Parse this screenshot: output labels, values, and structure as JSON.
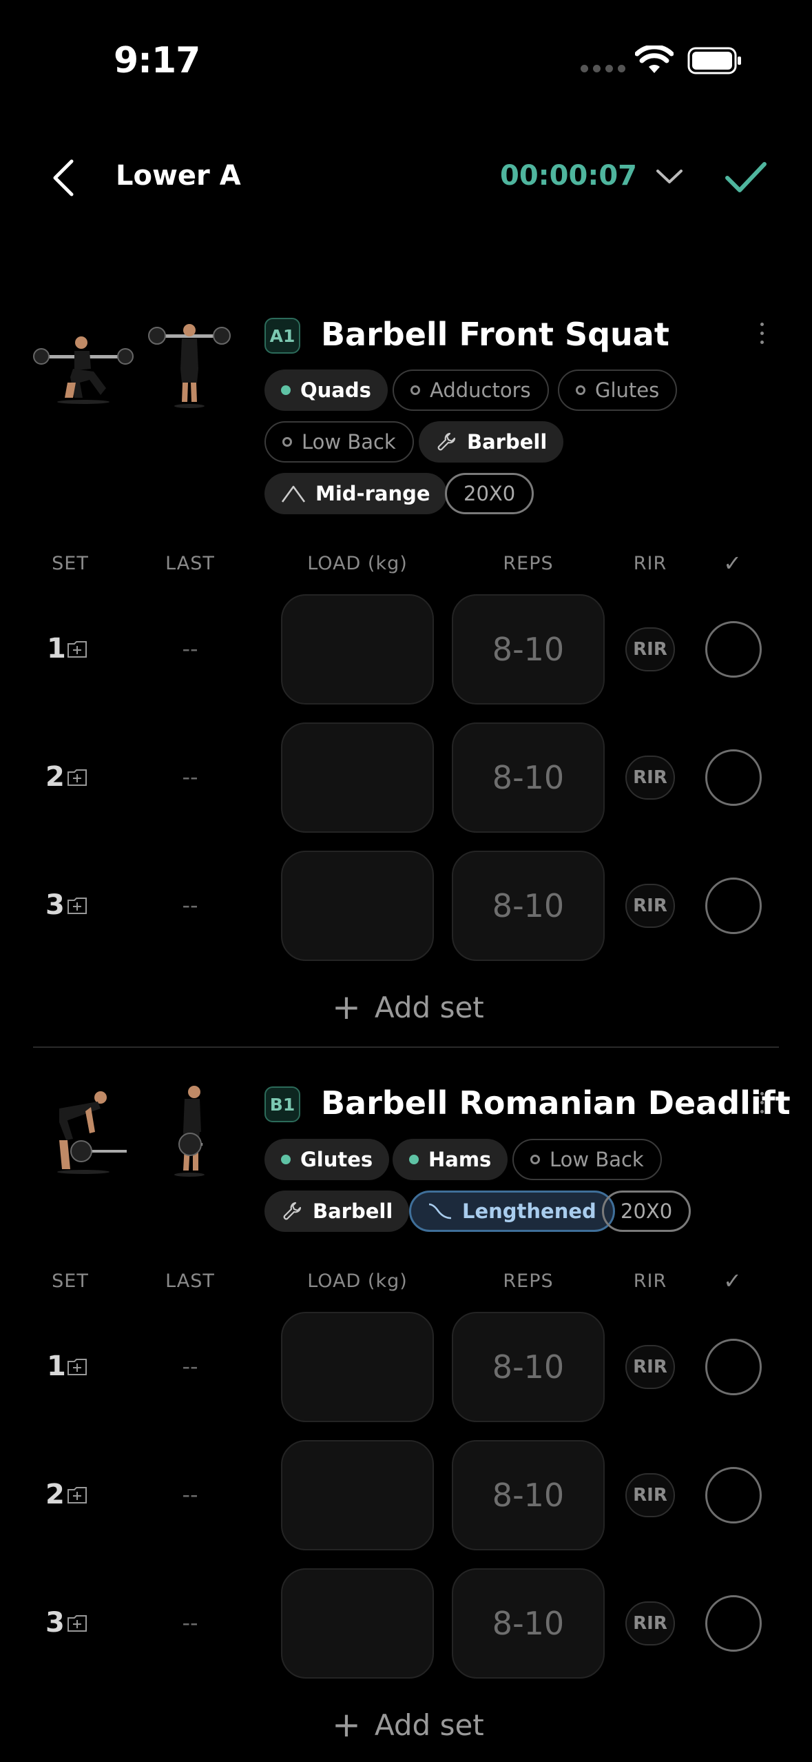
{
  "status_bar": {
    "time": "9:17"
  },
  "header": {
    "title": "Lower A",
    "timer": "00:00:07"
  },
  "exercises": [
    {
      "label": "A1",
      "name": "Barbell Front Squat",
      "chips": [
        "Quads",
        "Adductors",
        "Glutes",
        "Low Back",
        "Barbell",
        "Mid-range",
        "20X0"
      ],
      "columns": {
        "set": "SET",
        "last": "LAST",
        "load": "LOAD (kg)",
        "reps": "REPS",
        "rir": "RIR",
        "check": "✓"
      },
      "sets": [
        {
          "num": "1",
          "last": "--",
          "reps": "8-10",
          "rir": "RIR"
        },
        {
          "num": "2",
          "last": "--",
          "reps": "8-10",
          "rir": "RIR"
        },
        {
          "num": "3",
          "last": "--",
          "reps": "8-10",
          "rir": "RIR"
        }
      ],
      "add_set": "Add set"
    },
    {
      "label": "B1",
      "name": "Barbell Romanian Deadlift",
      "chips": [
        "Glutes",
        "Hams",
        "Low Back",
        "Barbell",
        "Lengthened",
        "20X0"
      ],
      "columns": {
        "set": "SET",
        "last": "LAST",
        "load": "LOAD (kg)",
        "reps": "REPS",
        "rir": "RIR",
        "check": "✓"
      },
      "sets": [
        {
          "num": "1",
          "last": "--",
          "reps": "8-10",
          "rir": "RIR"
        },
        {
          "num": "2",
          "last": "--",
          "reps": "8-10",
          "rir": "RIR"
        },
        {
          "num": "3",
          "last": "--",
          "reps": "8-10",
          "rir": "RIR"
        }
      ],
      "add_set": "Add set"
    }
  ],
  "colors": {
    "accent": "#4fb59e",
    "muscle_primary": "#5fc3a5",
    "lengthened": "#a9cdee"
  }
}
